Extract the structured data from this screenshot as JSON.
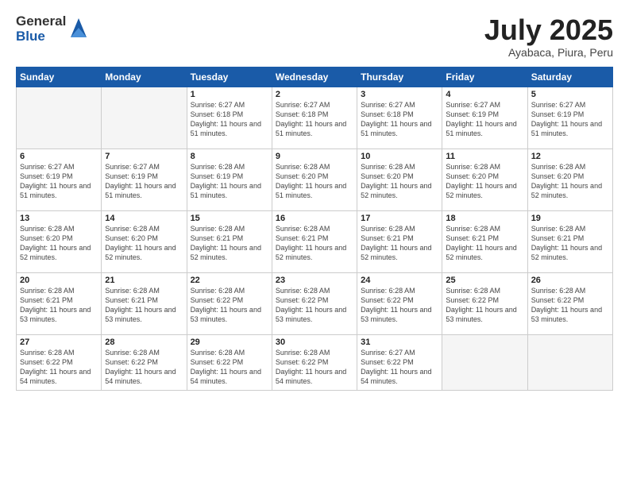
{
  "logo": {
    "general": "General",
    "blue": "Blue"
  },
  "title": {
    "month": "July 2025",
    "location": "Ayabaca, Piura, Peru"
  },
  "weekdays": [
    "Sunday",
    "Monday",
    "Tuesday",
    "Wednesday",
    "Thursday",
    "Friday",
    "Saturday"
  ],
  "weeks": [
    [
      {
        "day": "",
        "empty": true
      },
      {
        "day": "",
        "empty": true
      },
      {
        "day": "1",
        "sunrise": "6:27 AM",
        "sunset": "6:18 PM",
        "daylight": "11 hours and 51 minutes."
      },
      {
        "day": "2",
        "sunrise": "6:27 AM",
        "sunset": "6:18 PM",
        "daylight": "11 hours and 51 minutes."
      },
      {
        "day": "3",
        "sunrise": "6:27 AM",
        "sunset": "6:18 PM",
        "daylight": "11 hours and 51 minutes."
      },
      {
        "day": "4",
        "sunrise": "6:27 AM",
        "sunset": "6:19 PM",
        "daylight": "11 hours and 51 minutes."
      },
      {
        "day": "5",
        "sunrise": "6:27 AM",
        "sunset": "6:19 PM",
        "daylight": "11 hours and 51 minutes."
      }
    ],
    [
      {
        "day": "6",
        "sunrise": "6:27 AM",
        "sunset": "6:19 PM",
        "daylight": "11 hours and 51 minutes."
      },
      {
        "day": "7",
        "sunrise": "6:27 AM",
        "sunset": "6:19 PM",
        "daylight": "11 hours and 51 minutes."
      },
      {
        "day": "8",
        "sunrise": "6:28 AM",
        "sunset": "6:19 PM",
        "daylight": "11 hours and 51 minutes."
      },
      {
        "day": "9",
        "sunrise": "6:28 AM",
        "sunset": "6:20 PM",
        "daylight": "11 hours and 51 minutes."
      },
      {
        "day": "10",
        "sunrise": "6:28 AM",
        "sunset": "6:20 PM",
        "daylight": "11 hours and 52 minutes."
      },
      {
        "day": "11",
        "sunrise": "6:28 AM",
        "sunset": "6:20 PM",
        "daylight": "11 hours and 52 minutes."
      },
      {
        "day": "12",
        "sunrise": "6:28 AM",
        "sunset": "6:20 PM",
        "daylight": "11 hours and 52 minutes."
      }
    ],
    [
      {
        "day": "13",
        "sunrise": "6:28 AM",
        "sunset": "6:20 PM",
        "daylight": "11 hours and 52 minutes."
      },
      {
        "day": "14",
        "sunrise": "6:28 AM",
        "sunset": "6:20 PM",
        "daylight": "11 hours and 52 minutes."
      },
      {
        "day": "15",
        "sunrise": "6:28 AM",
        "sunset": "6:21 PM",
        "daylight": "11 hours and 52 minutes."
      },
      {
        "day": "16",
        "sunrise": "6:28 AM",
        "sunset": "6:21 PM",
        "daylight": "11 hours and 52 minutes."
      },
      {
        "day": "17",
        "sunrise": "6:28 AM",
        "sunset": "6:21 PM",
        "daylight": "11 hours and 52 minutes."
      },
      {
        "day": "18",
        "sunrise": "6:28 AM",
        "sunset": "6:21 PM",
        "daylight": "11 hours and 52 minutes."
      },
      {
        "day": "19",
        "sunrise": "6:28 AM",
        "sunset": "6:21 PM",
        "daylight": "11 hours and 52 minutes."
      }
    ],
    [
      {
        "day": "20",
        "sunrise": "6:28 AM",
        "sunset": "6:21 PM",
        "daylight": "11 hours and 53 minutes."
      },
      {
        "day": "21",
        "sunrise": "6:28 AM",
        "sunset": "6:21 PM",
        "daylight": "11 hours and 53 minutes."
      },
      {
        "day": "22",
        "sunrise": "6:28 AM",
        "sunset": "6:22 PM",
        "daylight": "11 hours and 53 minutes."
      },
      {
        "day": "23",
        "sunrise": "6:28 AM",
        "sunset": "6:22 PM",
        "daylight": "11 hours and 53 minutes."
      },
      {
        "day": "24",
        "sunrise": "6:28 AM",
        "sunset": "6:22 PM",
        "daylight": "11 hours and 53 minutes."
      },
      {
        "day": "25",
        "sunrise": "6:28 AM",
        "sunset": "6:22 PM",
        "daylight": "11 hours and 53 minutes."
      },
      {
        "day": "26",
        "sunrise": "6:28 AM",
        "sunset": "6:22 PM",
        "daylight": "11 hours and 53 minutes."
      }
    ],
    [
      {
        "day": "27",
        "sunrise": "6:28 AM",
        "sunset": "6:22 PM",
        "daylight": "11 hours and 54 minutes."
      },
      {
        "day": "28",
        "sunrise": "6:28 AM",
        "sunset": "6:22 PM",
        "daylight": "11 hours and 54 minutes."
      },
      {
        "day": "29",
        "sunrise": "6:28 AM",
        "sunset": "6:22 PM",
        "daylight": "11 hours and 54 minutes."
      },
      {
        "day": "30",
        "sunrise": "6:28 AM",
        "sunset": "6:22 PM",
        "daylight": "11 hours and 54 minutes."
      },
      {
        "day": "31",
        "sunrise": "6:27 AM",
        "sunset": "6:22 PM",
        "daylight": "11 hours and 54 minutes."
      },
      {
        "day": "",
        "empty": true
      },
      {
        "day": "",
        "empty": true
      }
    ]
  ]
}
